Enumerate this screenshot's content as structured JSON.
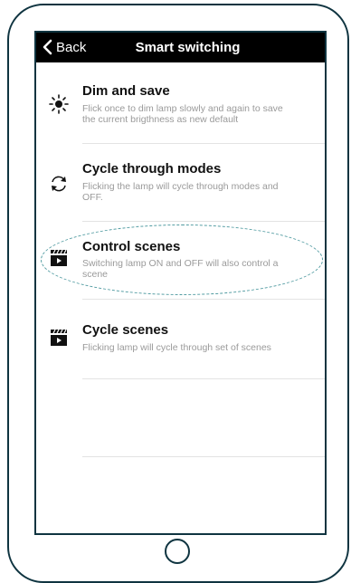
{
  "navbar": {
    "back_label": "Back",
    "title": "Smart switching"
  },
  "items": [
    {
      "title": "Dim and save",
      "description": "Flick once to dim lamp slowly and again to save the current brigthness as new default",
      "icon": "sun-icon"
    },
    {
      "title": "Cycle through modes",
      "description": "Flicking the lamp will cycle through modes and OFF.",
      "icon": "cycle-arrows-icon"
    },
    {
      "title": "Control scenes",
      "description": "Switching lamp ON and OFF will also control a scene",
      "icon": "clapperboard-icon",
      "highlighted": true
    },
    {
      "title": "Cycle scenes",
      "description": "Flicking lamp will cycle through set of scenes",
      "icon": "clapperboard-icon"
    }
  ],
  "colors": {
    "frame": "#0f3440",
    "navbar_bg": "#000000",
    "title_text": "#111111",
    "description_text": "#9a9a9a",
    "highlight_dash": "#4f9aa0"
  }
}
